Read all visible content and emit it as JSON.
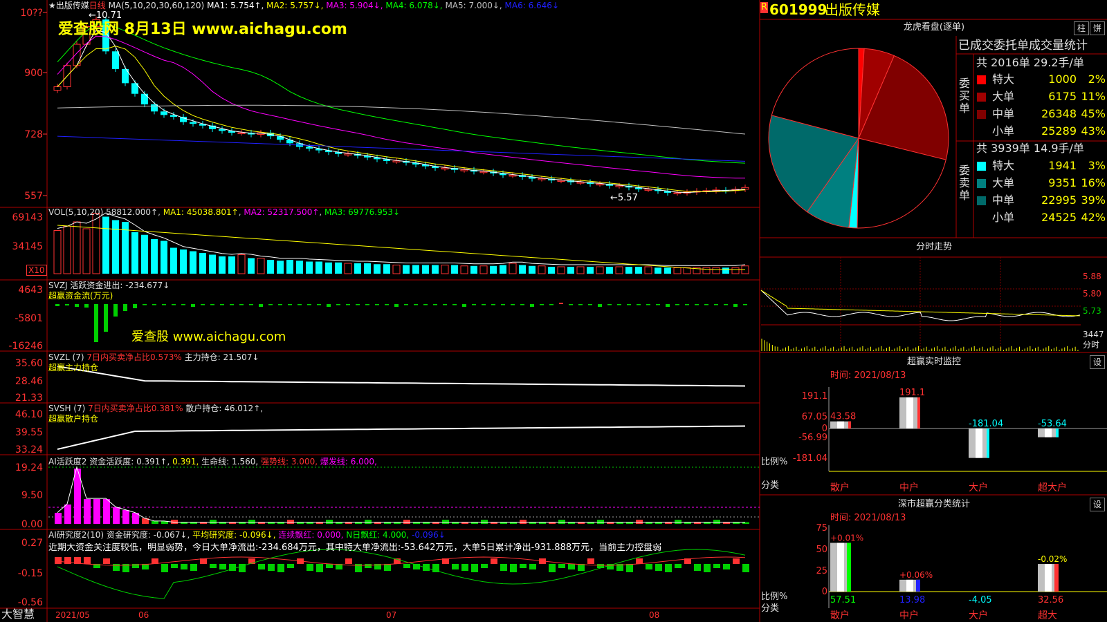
{
  "colors": {
    "red": "#ff3232",
    "cyan": "#00ffff",
    "green": "#00d000",
    "yellow": "#ffff00",
    "magenta": "#ff00ff",
    "white": "#ffffff",
    "blue": "#2020ff",
    "gray": "#a0a0a0",
    "dark_red": "#800000",
    "teal": "#008080",
    "border": "#b00000"
  },
  "kline": {
    "title_prefix": "★出版传媒",
    "period_label": "日线",
    "ma_label": "MA(5,10,20,30,60,120)",
    "ma_values": [
      {
        "label": "MA1: 5.754↑",
        "color": "#ffffff"
      },
      {
        "label": "MA2: 5.757↓",
        "color": "#ffff00"
      },
      {
        "label": "MA3: 5.904↓",
        "color": "#ff00ff"
      },
      {
        "label": "MA4: 6.078↓",
        "color": "#00ff00"
      },
      {
        "label": "MA5: 7.000↓",
        "color": "#c0c0c0"
      },
      {
        "label": "MA6: 6.646↓",
        "color": "#2020ff"
      }
    ],
    "y_ticks": [
      "10??",
      "900",
      "728",
      "557"
    ],
    "high_label": "←10.71",
    "low_label": "←5.57",
    "watermark_line": "爱查股网   8月13日   www.aichagu.com"
  },
  "vol": {
    "title": "VOL(5,10,20)",
    "value": "58812.000↑",
    "ma1": "MA1: 45038.801↑",
    "ma2": "MA2: 52317.500↑",
    "ma3": "MA3: 69776.953↓",
    "y_ticks": [
      "69143",
      "34145"
    ],
    "unit": "X10"
  },
  "svzj": {
    "title": "SVZJ  活跃资金进出: -234.677↓",
    "subtitle": "超赢资金流(万元)",
    "y_ticks": [
      "4643",
      "-5801",
      "-16246"
    ],
    "watermark": "爱查股 www.aichagu.com"
  },
  "svzl": {
    "title": "SVZL (7)",
    "stat": "7日内买卖净占比0.573%",
    "hold": "主力持仓: 21.507↓",
    "subtitle": "超赢主力持仓",
    "y_ticks": [
      "35.60",
      "28.46",
      "21.33"
    ]
  },
  "svsh": {
    "title": "SVSH (7)",
    "stat": "7日内买卖净占比0.381%",
    "hold": "散户持仓: 46.012↑,",
    "subtitle": "超赢散户持仓",
    "y_ticks": [
      "46.10",
      "39.55",
      "33.24"
    ]
  },
  "ai1": {
    "title": "AI活跃度2",
    "activity": "资金活跃度: 0.391↑,",
    "v2": "0.391,",
    "life": "生命线: 1.560,",
    "strong": "强势线: 3.000,",
    "burst": "爆发线: 6.000,",
    "y_ticks": [
      "19.24",
      "9.50",
      "0.00"
    ]
  },
  "ai2": {
    "title": "AI研究度2(10)",
    "research": "资金研究度: -0.067↓,",
    "avg": "平均研究度: -0.096↓,",
    "lianxu": "连续飘红: 0.000,",
    "nday": "N日飘红: 4.000,",
    "last": "-0.096↓",
    "comment": "近期大资金关注度较低，明显弱势，今日大单净流出:-234.684万元，其中特大单净流出:-53.642万元，大单5日累计净出-931.888万元，当前主力控盘弱",
    "y_ticks": [
      "0.27",
      "-0.15",
      "-0.56"
    ]
  },
  "xaxis": {
    "labels": [
      "2021/05",
      "06",
      "07",
      "08"
    ],
    "app_name": "大智慧"
  },
  "stock": {
    "badge": "R",
    "code": "601999",
    "name": "出版传媒"
  },
  "longhu": {
    "title": "龙虎看盘(逐单)",
    "btn_zhu": "柱",
    "btn_bing": "饼",
    "table_title": "已成交委托单成交量统计",
    "buy_total": "共 2016单 29.2手/单",
    "buy_label": "委买单",
    "buy_rows": [
      {
        "name": "特大",
        "value": "1000",
        "pct": "2%",
        "color": "#ff0000"
      },
      {
        "name": "大单",
        "value": "6175",
        "pct": "11%",
        "color": "#a00000"
      },
      {
        "name": "中单",
        "value": "26348",
        "pct": "45%",
        "color": "#800000"
      },
      {
        "name": "小单",
        "value": "25289",
        "pct": "43%",
        "color": "#000000"
      }
    ],
    "sell_total": "共 3939单 14.9手/单",
    "sell_label": "委卖单",
    "sell_rows": [
      {
        "name": "特大",
        "value": "1941",
        "pct": "3%",
        "color": "#00ffff"
      },
      {
        "name": "大单",
        "value": "9351",
        "pct": "16%",
        "color": "#008080"
      },
      {
        "name": "中单",
        "value": "22995",
        "pct": "39%",
        "color": "#006a6a"
      },
      {
        "name": "小单",
        "value": "24525",
        "pct": "42%",
        "color": "#000000"
      }
    ]
  },
  "intraday": {
    "title": "分时走势",
    "y_ticks": [
      "5.88",
      "5.80",
      "5.73"
    ],
    "vol_tick": "3447",
    "unit_label": "分时"
  },
  "monitor": {
    "title": "超赢实时监控",
    "btn": "设",
    "date": "时间: 2021/08/13",
    "y_ticks": [
      "191.1",
      "67.05",
      "0",
      "-56.99",
      "-181.04"
    ],
    "ratio_label": "比例%",
    "category_label": "分类",
    "bars": [
      {
        "cat": "散户",
        "value": 43.58,
        "label": "43.58",
        "color": "#ff3232"
      },
      {
        "cat": "中户",
        "value": 191.1,
        "label": "191.1",
        "color": "#ff3232"
      },
      {
        "cat": "大户",
        "value": -181.04,
        "label": "-181.04",
        "color": "#00ffff"
      },
      {
        "cat": "超大户",
        "value": -53.64,
        "label": "-53.64",
        "color": "#00ffff"
      }
    ]
  },
  "shenzhen": {
    "title": "深市超赢分类统计",
    "btn": "设",
    "date": "时间: 2021/08/13",
    "y_ticks": [
      "75",
      "50",
      "25",
      "0"
    ],
    "ratio_label": "比例%",
    "category_label": "分类",
    "bars": [
      {
        "cat": "散户",
        "value": 57.51,
        "label": "57.51",
        "top": "+0.01%",
        "color": "#00ff00"
      },
      {
        "cat": "中户",
        "value": 13.98,
        "label": "13.98",
        "top": "+0.06%",
        "color": "#2020ff"
      },
      {
        "cat": "大户",
        "value": -4.05,
        "label": "-4.05",
        "top": "",
        "color": "#00ffff"
      },
      {
        "cat": "超大",
        "value": 32.56,
        "label": "32.56",
        "top": "-0.02%",
        "color": "#ff3232"
      }
    ]
  }
}
